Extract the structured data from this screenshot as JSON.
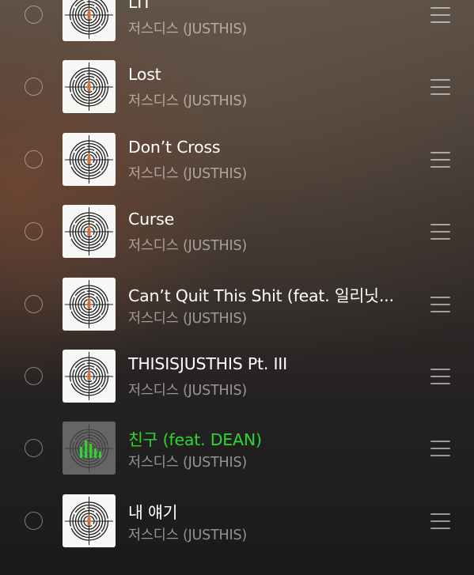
{
  "colors": {
    "active_title": "#2fd52f",
    "title": "#ffffff",
    "artist": "#9a9592"
  },
  "tracks": [
    {
      "title": "LIT",
      "artist": "저스디스 (JUSTHIS)",
      "playing": false
    },
    {
      "title": "Lost",
      "artist": "저스디스 (JUSTHIS)",
      "playing": false
    },
    {
      "title": "Don’t Cross",
      "artist": "저스디스 (JUSTHIS)",
      "playing": false
    },
    {
      "title": "Curse",
      "artist": "저스디스 (JUSTHIS)",
      "playing": false
    },
    {
      "title": "Can’t Quit This Shit (feat. 일리닛...",
      "artist": "저스디스 (JUSTHIS)",
      "playing": false
    },
    {
      "title": "THISISJUSTHIS Pt. III",
      "artist": "저스디스 (JUSTHIS)",
      "playing": false
    },
    {
      "title": "친구 (feat. DEAN)",
      "artist": "저스디스 (JUSTHIS)",
      "playing": true
    },
    {
      "title": "내 얘기",
      "artist": "저스디스 (JUSTHIS)",
      "playing": false
    }
  ],
  "icons": {
    "select": "circle-outline-icon",
    "artwork": "labyrinth-album-art",
    "playing": "equalizer-icon",
    "reorder": "drag-handle-icon"
  }
}
